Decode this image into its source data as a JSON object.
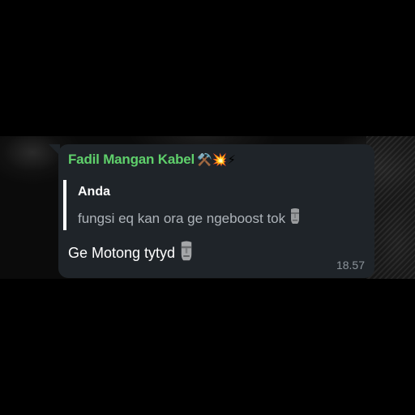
{
  "colors": {
    "sender_name": "#5fd06b",
    "bubble_bg": "#1f2429",
    "quote_bar": "#ffffff",
    "quote_text": "#aeb4ba",
    "timestamp": "#8c949b"
  },
  "message": {
    "sender": "Fadil Mangan Kabel",
    "sender_emojis": "⚒️💥⚡",
    "reply": {
      "author": "Anda",
      "text": "fungsi eq kan ora ge ngeboost tok"
    },
    "text": "Ge Motong tytyd",
    "time": "18.57",
    "icons": {
      "reply_emoji": "moai-icon",
      "message_emoji": "moai-icon"
    }
  }
}
